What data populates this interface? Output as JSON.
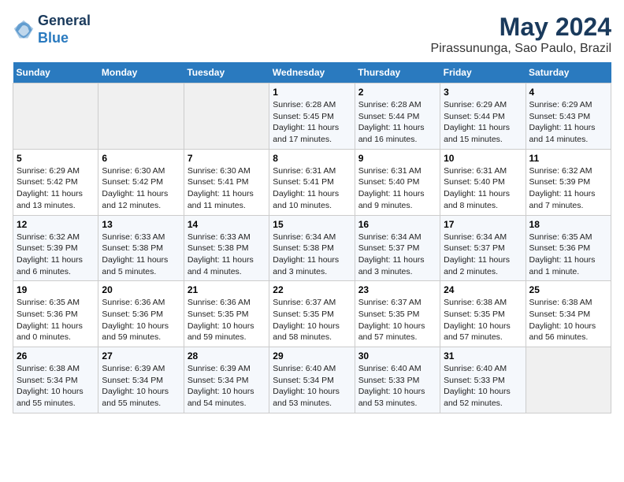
{
  "header": {
    "logo_line1": "General",
    "logo_line2": "Blue",
    "title": "May 2024",
    "subtitle": "Pirassununga, Sao Paulo, Brazil"
  },
  "weekdays": [
    "Sunday",
    "Monday",
    "Tuesday",
    "Wednesday",
    "Thursday",
    "Friday",
    "Saturday"
  ],
  "weeks": [
    [
      {
        "day": "",
        "info": ""
      },
      {
        "day": "",
        "info": ""
      },
      {
        "day": "",
        "info": ""
      },
      {
        "day": "1",
        "info": "Sunrise: 6:28 AM\nSunset: 5:45 PM\nDaylight: 11 hours\nand 17 minutes."
      },
      {
        "day": "2",
        "info": "Sunrise: 6:28 AM\nSunset: 5:44 PM\nDaylight: 11 hours\nand 16 minutes."
      },
      {
        "day": "3",
        "info": "Sunrise: 6:29 AM\nSunset: 5:44 PM\nDaylight: 11 hours\nand 15 minutes."
      },
      {
        "day": "4",
        "info": "Sunrise: 6:29 AM\nSunset: 5:43 PM\nDaylight: 11 hours\nand 14 minutes."
      }
    ],
    [
      {
        "day": "5",
        "info": "Sunrise: 6:29 AM\nSunset: 5:42 PM\nDaylight: 11 hours\nand 13 minutes."
      },
      {
        "day": "6",
        "info": "Sunrise: 6:30 AM\nSunset: 5:42 PM\nDaylight: 11 hours\nand 12 minutes."
      },
      {
        "day": "7",
        "info": "Sunrise: 6:30 AM\nSunset: 5:41 PM\nDaylight: 11 hours\nand 11 minutes."
      },
      {
        "day": "8",
        "info": "Sunrise: 6:31 AM\nSunset: 5:41 PM\nDaylight: 11 hours\nand 10 minutes."
      },
      {
        "day": "9",
        "info": "Sunrise: 6:31 AM\nSunset: 5:40 PM\nDaylight: 11 hours\nand 9 minutes."
      },
      {
        "day": "10",
        "info": "Sunrise: 6:31 AM\nSunset: 5:40 PM\nDaylight: 11 hours\nand 8 minutes."
      },
      {
        "day": "11",
        "info": "Sunrise: 6:32 AM\nSunset: 5:39 PM\nDaylight: 11 hours\nand 7 minutes."
      }
    ],
    [
      {
        "day": "12",
        "info": "Sunrise: 6:32 AM\nSunset: 5:39 PM\nDaylight: 11 hours\nand 6 minutes."
      },
      {
        "day": "13",
        "info": "Sunrise: 6:33 AM\nSunset: 5:38 PM\nDaylight: 11 hours\nand 5 minutes."
      },
      {
        "day": "14",
        "info": "Sunrise: 6:33 AM\nSunset: 5:38 PM\nDaylight: 11 hours\nand 4 minutes."
      },
      {
        "day": "15",
        "info": "Sunrise: 6:34 AM\nSunset: 5:38 PM\nDaylight: 11 hours\nand 3 minutes."
      },
      {
        "day": "16",
        "info": "Sunrise: 6:34 AM\nSunset: 5:37 PM\nDaylight: 11 hours\nand 3 minutes."
      },
      {
        "day": "17",
        "info": "Sunrise: 6:34 AM\nSunset: 5:37 PM\nDaylight: 11 hours\nand 2 minutes."
      },
      {
        "day": "18",
        "info": "Sunrise: 6:35 AM\nSunset: 5:36 PM\nDaylight: 11 hours\nand 1 minute."
      }
    ],
    [
      {
        "day": "19",
        "info": "Sunrise: 6:35 AM\nSunset: 5:36 PM\nDaylight: 11 hours\nand 0 minutes."
      },
      {
        "day": "20",
        "info": "Sunrise: 6:36 AM\nSunset: 5:36 PM\nDaylight: 10 hours\nand 59 minutes."
      },
      {
        "day": "21",
        "info": "Sunrise: 6:36 AM\nSunset: 5:35 PM\nDaylight: 10 hours\nand 59 minutes."
      },
      {
        "day": "22",
        "info": "Sunrise: 6:37 AM\nSunset: 5:35 PM\nDaylight: 10 hours\nand 58 minutes."
      },
      {
        "day": "23",
        "info": "Sunrise: 6:37 AM\nSunset: 5:35 PM\nDaylight: 10 hours\nand 57 minutes."
      },
      {
        "day": "24",
        "info": "Sunrise: 6:38 AM\nSunset: 5:35 PM\nDaylight: 10 hours\nand 57 minutes."
      },
      {
        "day": "25",
        "info": "Sunrise: 6:38 AM\nSunset: 5:34 PM\nDaylight: 10 hours\nand 56 minutes."
      }
    ],
    [
      {
        "day": "26",
        "info": "Sunrise: 6:38 AM\nSunset: 5:34 PM\nDaylight: 10 hours\nand 55 minutes."
      },
      {
        "day": "27",
        "info": "Sunrise: 6:39 AM\nSunset: 5:34 PM\nDaylight: 10 hours\nand 55 minutes."
      },
      {
        "day": "28",
        "info": "Sunrise: 6:39 AM\nSunset: 5:34 PM\nDaylight: 10 hours\nand 54 minutes."
      },
      {
        "day": "29",
        "info": "Sunrise: 6:40 AM\nSunset: 5:34 PM\nDaylight: 10 hours\nand 53 minutes."
      },
      {
        "day": "30",
        "info": "Sunrise: 6:40 AM\nSunset: 5:33 PM\nDaylight: 10 hours\nand 53 minutes."
      },
      {
        "day": "31",
        "info": "Sunrise: 6:40 AM\nSunset: 5:33 PM\nDaylight: 10 hours\nand 52 minutes."
      },
      {
        "day": "",
        "info": ""
      }
    ]
  ]
}
